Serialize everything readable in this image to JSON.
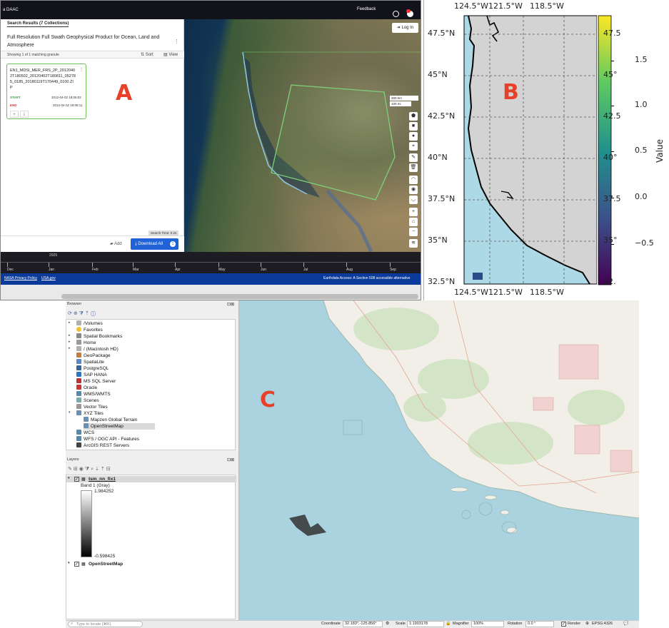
{
  "panel_a": {
    "letter": "A",
    "app_title": "a DAAC",
    "feedback": "Feedback",
    "login": "Log In",
    "search_results_tab": "Search Results (7 Collections)",
    "collection_title": "Full Resolution Full Swath Geophysical Product for Ocean, Land and Atmosphere",
    "granule_count": "Showing 1 of 1 matching granule",
    "sort_label": "Sort",
    "view_label": "View",
    "granule": {
      "name": "EN1_MDSI_MER_FRS_2P_20120402T180502_20120402T180811_052785_0185_20180119T170449_0100.ZIP",
      "start_label": "START",
      "start_value": "2012-04-02 18:05:02",
      "end_label": "END",
      "end_value": "2012-04-02 18:08:11"
    },
    "search_time": "Search Time: 0.2s",
    "add_label": "Add",
    "download_all": "Download All",
    "download_badge": "1",
    "scale_km": "300 km",
    "scale_mi": "100 mi",
    "timeline_year": "2025",
    "timeline_months": [
      "Dec",
      "Jan",
      "Feb",
      "Mar",
      "Apr",
      "May",
      "Jun",
      "Jul",
      "Aug",
      "Sep"
    ],
    "footer_left": [
      "NASA Privacy Policy",
      "USA.gov"
    ],
    "footer_right": "Earthdata Access: A Section 508 accessible alternative",
    "colors": {
      "topbar": "#12131a",
      "footer": "#0b3b9a",
      "download": "#1f63d6",
      "granule_green": "#6fbf5e"
    }
  },
  "panel_b": {
    "letter": "B",
    "x_ticks": [
      "124.5°W",
      "121.5°W",
      "118.5°W"
    ],
    "y_ticks": [
      "47.5°N",
      "45°N",
      "42.5°N",
      "40°N",
      "37.5°N",
      "35°N",
      "32.5°N"
    ],
    "right_ticks": [
      "47.5",
      "45°",
      "42.5",
      "40°",
      "37.5",
      "35°",
      "32."
    ],
    "colorbar_ticks": [
      "1.5",
      "1.0",
      "0.5",
      "0.0",
      "−0.5"
    ],
    "colorbar_label": "Value",
    "colors": {
      "land": "#d3d3d3",
      "ocean": "#add8e6",
      "coast": "#000000"
    }
  },
  "panel_c": {
    "letter": "C",
    "browser_title": "Browser",
    "browser_items": [
      {
        "label": "/Volumes",
        "icon": "folder-icon",
        "expand": true,
        "indent": 0
      },
      {
        "label": "Favorites",
        "icon": "star-icon",
        "expand": false,
        "indent": 0
      },
      {
        "label": "Spatial Bookmarks",
        "icon": "bookmark-icon",
        "expand": true,
        "indent": 0
      },
      {
        "label": "Home",
        "icon": "home-icon",
        "expand": true,
        "indent": 0
      },
      {
        "label": "/ (Macintosh HD)",
        "icon": "folder-icon",
        "expand": true,
        "indent": 0
      },
      {
        "label": "GeoPackage",
        "icon": "geopackage-icon",
        "expand": false,
        "indent": 0
      },
      {
        "label": "SpatiaLite",
        "icon": "spatialite-icon",
        "expand": false,
        "indent": 0
      },
      {
        "label": "PostgreSQL",
        "icon": "postgresql-icon",
        "expand": false,
        "indent": 0
      },
      {
        "label": "SAP HANA",
        "icon": "saphana-icon",
        "expand": false,
        "indent": 0
      },
      {
        "label": "MS SQL Server",
        "icon": "mssql-icon",
        "expand": false,
        "indent": 0
      },
      {
        "label": "Oracle",
        "icon": "oracle-icon",
        "expand": false,
        "indent": 0
      },
      {
        "label": "WMS/WMTS",
        "icon": "wms-icon",
        "expand": false,
        "indent": 0
      },
      {
        "label": "Scenes",
        "icon": "scenes-icon",
        "expand": false,
        "indent": 0
      },
      {
        "label": "Vector Tiles",
        "icon": "vectortiles-icon",
        "expand": false,
        "indent": 0
      },
      {
        "label": "XYZ Tiles",
        "icon": "xyz-icon",
        "expand": true,
        "indent": 0
      },
      {
        "label": "Mapzen Global Terrain",
        "icon": "xyz-icon",
        "expand": false,
        "indent": 1
      },
      {
        "label": "OpenStreetMap",
        "icon": "xyz-icon",
        "expand": false,
        "indent": 1
      },
      {
        "label": "WCS",
        "icon": "wcs-icon",
        "expand": false,
        "indent": 0
      },
      {
        "label": "WFS / OGC API - Features",
        "icon": "wfs-icon",
        "expand": false,
        "indent": 0
      },
      {
        "label": "ArcGIS REST Servers",
        "icon": "arcgis-icon",
        "expand": false,
        "indent": 0
      }
    ],
    "layers_title": "Layers",
    "layer1": {
      "name": "tsm_nn_fix1",
      "band": "Band 1 (Gray)",
      "max": "1.984252",
      "min": "-0.598425"
    },
    "layer2": {
      "name": "OpenStreetMap"
    },
    "locate_placeholder": "Type to locate (⌘K)",
    "coordinate_label": "Coordinate",
    "coordinate_value": "32.183°,-125.856°",
    "scale_label": "Scale",
    "scale_value": "1:1903178",
    "magnifier_label": "Magnifier",
    "magnifier_value": "100%",
    "rotation_label": "Rotation",
    "rotation_value": "0.0 °",
    "render_label": "Render",
    "crs": "EPSG:4326"
  }
}
